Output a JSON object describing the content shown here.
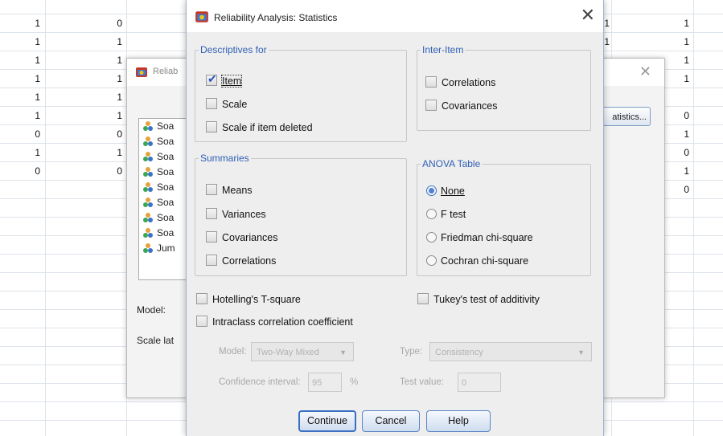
{
  "spreadsheet": {
    "left_col": [
      "1",
      "1",
      "1",
      "1",
      "1",
      "1",
      "0",
      "1",
      "0"
    ],
    "mid_col": [
      "0",
      "1",
      "1",
      "1",
      "1",
      "1",
      "0",
      "1",
      "0"
    ],
    "right_col": [
      "1",
      "1",
      "1",
      "1",
      "0",
      "1",
      "0",
      "1",
      "0"
    ],
    "peek_col": [
      "1",
      "1"
    ]
  },
  "back_dialog": {
    "title": "Reliab",
    "variables": [
      "Soa",
      "Soa",
      "Soa",
      "Soa",
      "Soa",
      "Soa",
      "Soa",
      "Soa",
      "Jum"
    ],
    "model_label": "Model:",
    "scale_label": "Scale lat",
    "statistics_button": "atistics..."
  },
  "dialog": {
    "title": "Reliability Analysis: Statistics",
    "descriptives": {
      "legend": "Descriptives for",
      "item": "Item",
      "scale": "Scale",
      "scale_if_deleted": "Scale if item deleted",
      "item_checked": true
    },
    "inter_item": {
      "legend": "Inter-Item",
      "correlations": "Correlations",
      "covariances": "Covariances"
    },
    "summaries": {
      "legend": "Summaries",
      "means": "Means",
      "variances": "Variances",
      "covariances": "Covariances",
      "correlations": "Correlations"
    },
    "anova": {
      "legend": "ANOVA Table",
      "none": "None",
      "f_test": "F test",
      "friedman": "Friedman chi-square",
      "cochran": "Cochran chi-square",
      "selected": "None"
    },
    "hotelling": "Hotelling's T-square",
    "tukey": "Tukey's test of additivity",
    "intraclass": "Intraclass correlation coefficient",
    "model_label": "Model:",
    "model_value": "Two-Way Mixed",
    "type_label": "Type:",
    "type_value": "Consistency",
    "ci_label": "Confidence interval:",
    "ci_value": "95",
    "ci_unit": "%",
    "test_value_label": "Test value:",
    "test_value": "0",
    "buttons": {
      "continue": "Continue",
      "cancel": "Cancel",
      "help": "Help"
    }
  }
}
